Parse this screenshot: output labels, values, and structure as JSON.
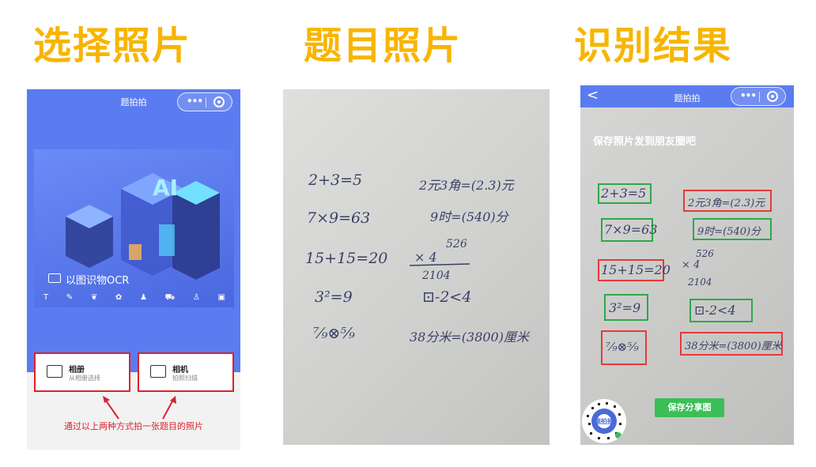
{
  "headings": [
    "选择照片",
    "题目照片",
    "识别结果"
  ],
  "panel1": {
    "title": "题拍拍",
    "banner_label": "以图识物OCR",
    "banner_icons": [
      "T",
      "✎",
      "❦",
      "✿",
      "♟",
      "⛟",
      "♙",
      "▣"
    ],
    "card_album": {
      "title": "相册",
      "subtitle": "从相册选择"
    },
    "card_camera": {
      "title": "相机",
      "subtitle": "拍照扫描"
    },
    "instruction": "通过以上两种方式拍一张题目的照片"
  },
  "panel2": {
    "lines": [
      "2+3=5",
      "2元3角=(2.3)元",
      "7×9=63",
      "9时=(540)分",
      "15+15=20",
      "526",
      "×   4",
      "2104",
      "3²=9",
      "⊡-2<4",
      "⁷⁄₉⊗⁵⁄₉",
      "38分米=(3800)厘米"
    ]
  },
  "panel3": {
    "title": "题拍拍",
    "back": "<",
    "save_text": "保存照片发到朋友圈吧",
    "share_button": "保存分享图",
    "qr_label": "题拍拍"
  },
  "colors": {
    "accent": "#f7b500",
    "blue": "#5b7cf0",
    "red": "#d9232d",
    "green": "#2ea84a"
  }
}
